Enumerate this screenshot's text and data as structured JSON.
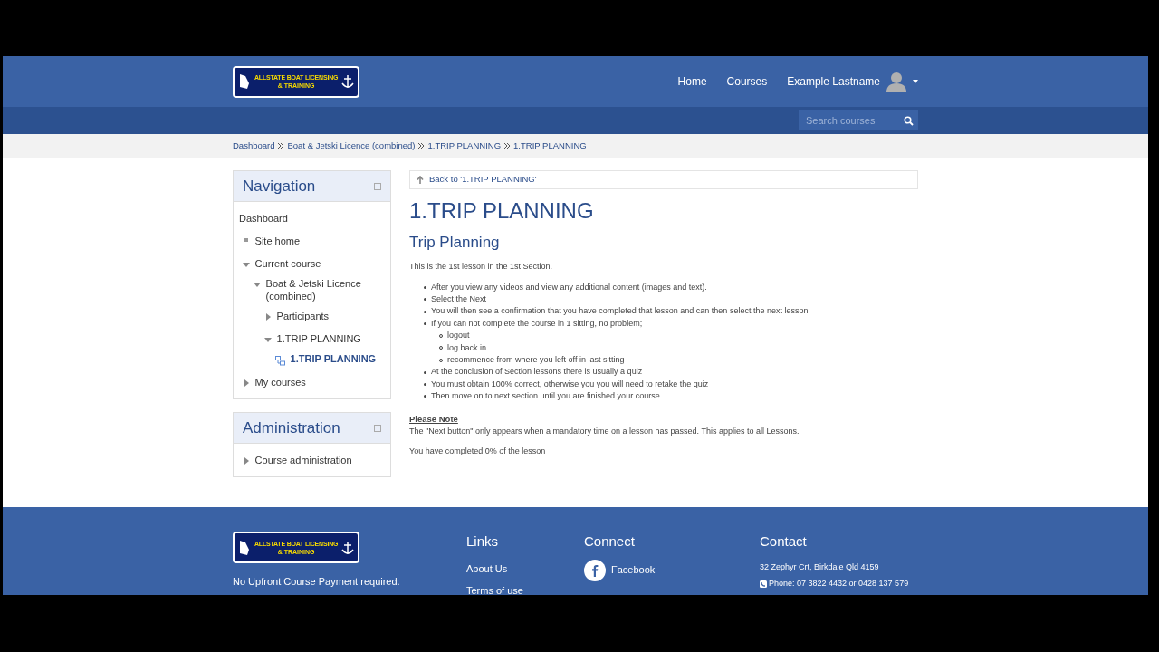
{
  "header": {
    "logo_lines": [
      "ALLSTATE BOAT LICENSING",
      "& TRAINING"
    ],
    "nav": [
      "Home",
      "Courses"
    ],
    "user": "Example Lastname"
  },
  "search": {
    "placeholder": "Search courses"
  },
  "breadcrumb": [
    "Dashboard",
    "Boat & Jetski Licence (combined)",
    "1.TRIP PLANNING",
    "1.TRIP PLANNING"
  ],
  "navigation": {
    "title": "Navigation",
    "items": [
      {
        "label": "Dashboard",
        "kind": "root"
      },
      {
        "label": "Site home",
        "kind": "leaf"
      },
      {
        "label": "Current course",
        "kind": "branch",
        "expanded": true,
        "children": [
          {
            "label": "Boat & Jetski Licence (combined)",
            "kind": "branch",
            "expanded": true,
            "children": [
              {
                "label": "Participants",
                "kind": "branch",
                "expanded": false
              },
              {
                "label": "1.TRIP PLANNING",
                "kind": "branch",
                "expanded": true,
                "children": [
                  {
                    "label": "1.TRIP PLANNING",
                    "kind": "page",
                    "selected": true
                  }
                ]
              }
            ]
          }
        ]
      },
      {
        "label": "My courses",
        "kind": "branch",
        "expanded": false
      }
    ]
  },
  "administration": {
    "title": "Administration",
    "items": [
      {
        "label": "Course administration",
        "kind": "branch",
        "expanded": false
      }
    ]
  },
  "main": {
    "back_link": "Back to '1.TRIP PLANNING'",
    "title": "1.TRIP PLANNING",
    "subtitle": "Trip Planning",
    "intro": "This is the 1st lesson in the 1st Section.",
    "bullets": [
      {
        "text": "After you view any videos and view any additional content (images and text)."
      },
      {
        "text": "Select the Next"
      },
      {
        "text": "You will then see a confirmation that you have completed that lesson and can then select the next lesson"
      },
      {
        "text": "If you can not complete the course in 1 sitting, no problem;",
        "children": [
          "logout",
          "log back in",
          "recommence from where you left off in last sitting"
        ]
      },
      {
        "text": "At the conclusion of Section lessons there is usually a quiz"
      },
      {
        "text": "You must obtain 100% correct, otherwise you you will need to retake the quiz"
      },
      {
        "text": "Then move on to next section until you are finished your course."
      }
    ],
    "note_heading": "Please Note",
    "note": "The \"Next button\" only appears when a mandatory time on a lesson has passed. This applies to all Lessons.",
    "progress": "You have completed 0% of the lesson"
  },
  "footer": {
    "logo_lines": [
      "ALLSTATE BOAT LICENSING",
      "& TRAINING"
    ],
    "tagline": "No Upfront Course Payment required.",
    "links_title": "Links",
    "links": [
      "About Us",
      "Terms of use"
    ],
    "connect_title": "Connect",
    "connect": [
      "Facebook"
    ],
    "contact_title": "Contact",
    "address": "32 Zephyr Crt, Birkdale Qld 4159",
    "phone": "Phone: 07 3822 4432 or 0428 137 579"
  }
}
